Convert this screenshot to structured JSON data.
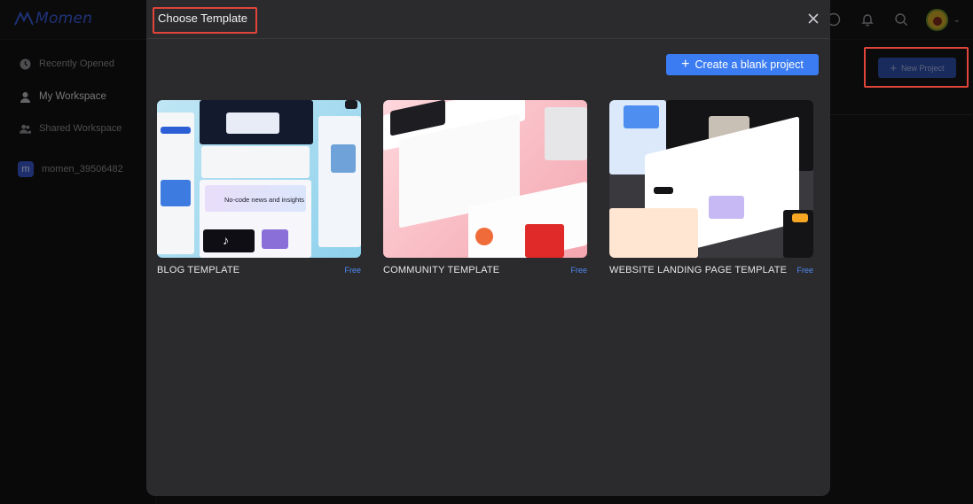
{
  "app": {
    "logo_text": "Momen"
  },
  "header": {
    "icons": [
      "help-icon",
      "bell-icon",
      "search-icon",
      "avatar",
      "chevron-down-icon"
    ]
  },
  "sidebar": {
    "items": [
      {
        "label": "Recently Opened",
        "icon": "clock-icon"
      },
      {
        "label": "My Workspace",
        "icon": "user-icon"
      },
      {
        "label": "Shared Workspace",
        "icon": "users-icon"
      }
    ],
    "workspace": {
      "badge": "m",
      "name": "momen_39506482"
    }
  },
  "main": {
    "new_project_label": "New Project"
  },
  "modal": {
    "title": "Choose Template",
    "create_label": "Create a blank project",
    "templates": [
      {
        "name": "BLOG TEMPLATE",
        "price": "Free",
        "preview_text": "No-code news and insights"
      },
      {
        "name": "COMMUNITY TEMPLATE",
        "price": "Free"
      },
      {
        "name": "WEBSITE LANDING PAGE TEMPLATE",
        "price": "Free"
      }
    ]
  },
  "colors": {
    "accent": "#3b7cf2",
    "highlight_frame": "#e0453a",
    "modal_bg": "#2b2b2e"
  }
}
